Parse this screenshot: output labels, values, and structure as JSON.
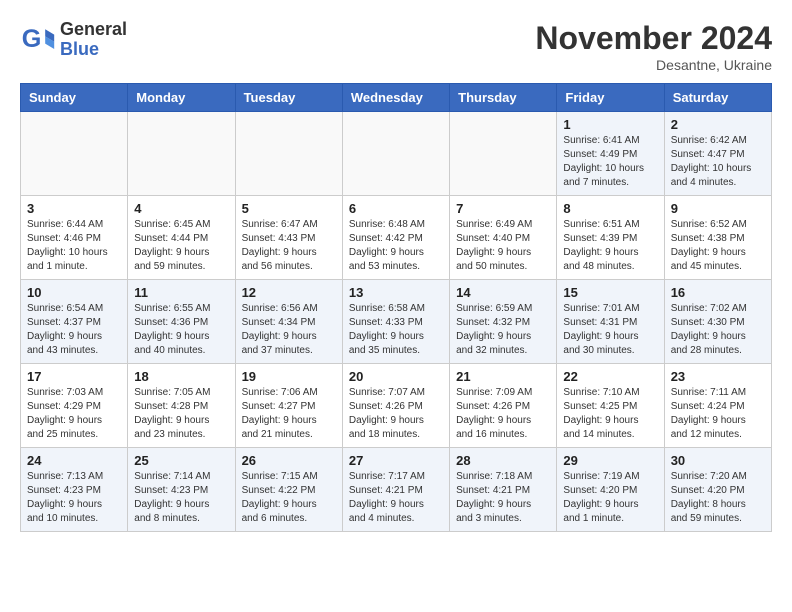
{
  "header": {
    "logo_general": "General",
    "logo_blue": "Blue",
    "month": "November 2024",
    "location": "Desantne, Ukraine"
  },
  "weekdays": [
    "Sunday",
    "Monday",
    "Tuesday",
    "Wednesday",
    "Thursday",
    "Friday",
    "Saturday"
  ],
  "weeks": [
    [
      {
        "day": "",
        "info": ""
      },
      {
        "day": "",
        "info": ""
      },
      {
        "day": "",
        "info": ""
      },
      {
        "day": "",
        "info": ""
      },
      {
        "day": "",
        "info": ""
      },
      {
        "day": "1",
        "info": "Sunrise: 6:41 AM\nSunset: 4:49 PM\nDaylight: 10 hours\nand 7 minutes."
      },
      {
        "day": "2",
        "info": "Sunrise: 6:42 AM\nSunset: 4:47 PM\nDaylight: 10 hours\nand 4 minutes."
      }
    ],
    [
      {
        "day": "3",
        "info": "Sunrise: 6:44 AM\nSunset: 4:46 PM\nDaylight: 10 hours\nand 1 minute."
      },
      {
        "day": "4",
        "info": "Sunrise: 6:45 AM\nSunset: 4:44 PM\nDaylight: 9 hours\nand 59 minutes."
      },
      {
        "day": "5",
        "info": "Sunrise: 6:47 AM\nSunset: 4:43 PM\nDaylight: 9 hours\nand 56 minutes."
      },
      {
        "day": "6",
        "info": "Sunrise: 6:48 AM\nSunset: 4:42 PM\nDaylight: 9 hours\nand 53 minutes."
      },
      {
        "day": "7",
        "info": "Sunrise: 6:49 AM\nSunset: 4:40 PM\nDaylight: 9 hours\nand 50 minutes."
      },
      {
        "day": "8",
        "info": "Sunrise: 6:51 AM\nSunset: 4:39 PM\nDaylight: 9 hours\nand 48 minutes."
      },
      {
        "day": "9",
        "info": "Sunrise: 6:52 AM\nSunset: 4:38 PM\nDaylight: 9 hours\nand 45 minutes."
      }
    ],
    [
      {
        "day": "10",
        "info": "Sunrise: 6:54 AM\nSunset: 4:37 PM\nDaylight: 9 hours\nand 43 minutes."
      },
      {
        "day": "11",
        "info": "Sunrise: 6:55 AM\nSunset: 4:36 PM\nDaylight: 9 hours\nand 40 minutes."
      },
      {
        "day": "12",
        "info": "Sunrise: 6:56 AM\nSunset: 4:34 PM\nDaylight: 9 hours\nand 37 minutes."
      },
      {
        "day": "13",
        "info": "Sunrise: 6:58 AM\nSunset: 4:33 PM\nDaylight: 9 hours\nand 35 minutes."
      },
      {
        "day": "14",
        "info": "Sunrise: 6:59 AM\nSunset: 4:32 PM\nDaylight: 9 hours\nand 32 minutes."
      },
      {
        "day": "15",
        "info": "Sunrise: 7:01 AM\nSunset: 4:31 PM\nDaylight: 9 hours\nand 30 minutes."
      },
      {
        "day": "16",
        "info": "Sunrise: 7:02 AM\nSunset: 4:30 PM\nDaylight: 9 hours\nand 28 minutes."
      }
    ],
    [
      {
        "day": "17",
        "info": "Sunrise: 7:03 AM\nSunset: 4:29 PM\nDaylight: 9 hours\nand 25 minutes."
      },
      {
        "day": "18",
        "info": "Sunrise: 7:05 AM\nSunset: 4:28 PM\nDaylight: 9 hours\nand 23 minutes."
      },
      {
        "day": "19",
        "info": "Sunrise: 7:06 AM\nSunset: 4:27 PM\nDaylight: 9 hours\nand 21 minutes."
      },
      {
        "day": "20",
        "info": "Sunrise: 7:07 AM\nSunset: 4:26 PM\nDaylight: 9 hours\nand 18 minutes."
      },
      {
        "day": "21",
        "info": "Sunrise: 7:09 AM\nSunset: 4:26 PM\nDaylight: 9 hours\nand 16 minutes."
      },
      {
        "day": "22",
        "info": "Sunrise: 7:10 AM\nSunset: 4:25 PM\nDaylight: 9 hours\nand 14 minutes."
      },
      {
        "day": "23",
        "info": "Sunrise: 7:11 AM\nSunset: 4:24 PM\nDaylight: 9 hours\nand 12 minutes."
      }
    ],
    [
      {
        "day": "24",
        "info": "Sunrise: 7:13 AM\nSunset: 4:23 PM\nDaylight: 9 hours\nand 10 minutes."
      },
      {
        "day": "25",
        "info": "Sunrise: 7:14 AM\nSunset: 4:23 PM\nDaylight: 9 hours\nand 8 minutes."
      },
      {
        "day": "26",
        "info": "Sunrise: 7:15 AM\nSunset: 4:22 PM\nDaylight: 9 hours\nand 6 minutes."
      },
      {
        "day": "27",
        "info": "Sunrise: 7:17 AM\nSunset: 4:21 PM\nDaylight: 9 hours\nand 4 minutes."
      },
      {
        "day": "28",
        "info": "Sunrise: 7:18 AM\nSunset: 4:21 PM\nDaylight: 9 hours\nand 3 minutes."
      },
      {
        "day": "29",
        "info": "Sunrise: 7:19 AM\nSunset: 4:20 PM\nDaylight: 9 hours\nand 1 minute."
      },
      {
        "day": "30",
        "info": "Sunrise: 7:20 AM\nSunset: 4:20 PM\nDaylight: 8 hours\nand 59 minutes."
      }
    ]
  ]
}
